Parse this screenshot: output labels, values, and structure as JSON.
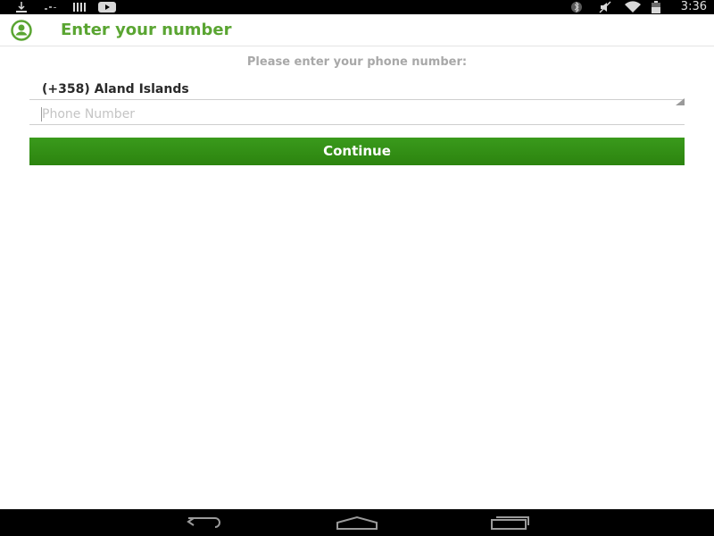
{
  "status_bar": {
    "left_icons": [
      "download-icon",
      "signal-bars-icon",
      "youtube-icon"
    ],
    "right_icons": [
      "bluetooth-icon",
      "mute-icon",
      "wifi-icon",
      "battery-icon"
    ],
    "time": "3:36"
  },
  "action_bar": {
    "icon": "person-circle-icon",
    "title": "Enter your number",
    "accent_color": "#5aa532"
  },
  "form": {
    "prompt": "Please enter your phone number:",
    "country_selected": "(+358) Aland Islands",
    "phone_placeholder": "Phone Number",
    "phone_value": "",
    "continue_label": "Continue",
    "button_color": "#34901a"
  },
  "nav_bar": {
    "buttons": [
      "back-icon",
      "home-icon",
      "recent-apps-icon"
    ]
  }
}
